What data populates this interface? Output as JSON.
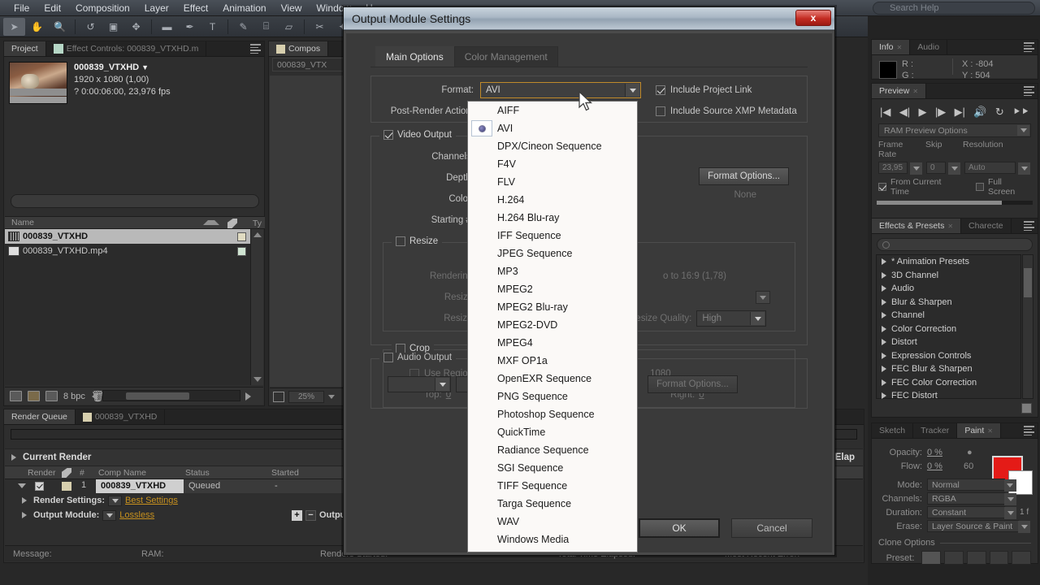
{
  "menubar": {
    "items": [
      "File",
      "Edit",
      "Composition",
      "Layer",
      "Effect",
      "Animation",
      "View",
      "Window",
      "H"
    ],
    "search_placeholder": "Search Help"
  },
  "project_panel": {
    "tabs": [
      {
        "label": "Project",
        "active": true
      },
      {
        "label": "Effect Controls: 000839_VTXHD.m",
        "active": false
      }
    ],
    "item_name": "000839_VTXHD",
    "item_dims": "1920 x 1080 (1,00)",
    "item_duration": "? 0:00:06:00, 23,976 fps",
    "search_placeholder": "",
    "column_name": "Name",
    "column_type": "Ty",
    "rows": [
      {
        "name": "000839_VTXHD",
        "selected": true
      },
      {
        "name": "000839_VTXHD.mp4",
        "selected": false
      }
    ],
    "bit_depth": "8 bpc"
  },
  "comp_panel": {
    "tab_label": "Compos",
    "sub_label": "000839_VTX",
    "zoom": "25%"
  },
  "render_queue": {
    "tabs": [
      {
        "label": "Render Queue",
        "active": true
      },
      {
        "label": "000839_VTXHD",
        "active": false
      }
    ],
    "current_render_label": "Current Render",
    "elapsed_label": "Elap",
    "columns": [
      "Render",
      "#",
      "Comp Name",
      "Status",
      "Started"
    ],
    "row": {
      "index": "1",
      "comp_name": "000839_VTXHD",
      "status": "Queued",
      "started": "-"
    },
    "render_settings_label": "Render Settings:",
    "render_settings_value": "Best Settings",
    "output_module_label": "Output Module:",
    "output_module_value": "Lossless",
    "output_to_label": "Outpu",
    "status_bar": [
      "Message:",
      "RAM:",
      "Renders Started:",
      "Total Time Elapsed:",
      "Most Recent Error:"
    ]
  },
  "info_panel": {
    "tabs": [
      {
        "label": "Info",
        "active": true
      },
      {
        "label": "Audio",
        "active": false
      }
    ],
    "r_label": "R :",
    "g_label": "G :",
    "x_label": "X : -804",
    "y_label": "Y : 504"
  },
  "preview_panel": {
    "tabs": [
      {
        "label": "Preview",
        "active": true
      }
    ],
    "ram_preview_options": "RAM Preview Options",
    "frame_rate_label": "Frame Rate",
    "frame_rate_value": "23,95",
    "skip_label": "Skip",
    "skip_value": "0",
    "resolution_label": "Resolution",
    "resolution_value": "Auto",
    "from_current_time": "From Current Time",
    "full_screen": "Full Screen"
  },
  "effects_panel": {
    "tabs": [
      {
        "label": "Effects & Presets",
        "active": true
      },
      {
        "label": "Charecte",
        "active": false
      }
    ],
    "search_placeholder": "",
    "items": [
      "* Animation Presets",
      "3D Channel",
      "Audio",
      "Blur & Sharpen",
      "Channel",
      "Color Correction",
      "Distort",
      "Expression Controls",
      "FEC Blur & Sharpen",
      "FEC Color Correction",
      "FEC Distort"
    ]
  },
  "paint_panel": {
    "tabs": [
      {
        "label": "Sketch",
        "active": false
      },
      {
        "label": "Tracker",
        "active": false
      },
      {
        "label": "Paint",
        "active": true
      }
    ],
    "opacity_label": "Opacity:",
    "opacity_value": "0 %",
    "flow_label": "Flow:",
    "flow_value": "0 %",
    "brush_size": "60",
    "mode_label": "Mode:",
    "mode_value": "Normal",
    "channels_label": "Channels:",
    "channels_value": "RGBA",
    "duration_label": "Duration:",
    "duration_value": "Constant",
    "erase_label": "Erase:",
    "erase_value": "Layer Source & Paint",
    "clone_options_label": "Clone Options",
    "preset_label": "Preset:",
    "foreground_color": "#e41b17",
    "background_color": "#ffffff"
  },
  "dialog": {
    "title": "Output Module Settings",
    "close_label": "x",
    "tabs": [
      {
        "label": "Main Options",
        "active": true
      },
      {
        "label": "Color Management",
        "active": false
      }
    ],
    "format_label": "Format:",
    "format_value": "AVI",
    "post_render_label": "Post-Render Action:",
    "include_project_link": "Include Project Link",
    "include_xmp": "Include Source XMP Metadata",
    "video_output": "Video Output",
    "channels_label": "Channels:",
    "depth_label": "Depth:",
    "color_label": "Color:",
    "starting_label": "Starting #:",
    "format_options_button": "Format Options...",
    "format_options_value": "None",
    "resize_label": "Resize",
    "resize_note": "o to 16:9 (1,78)",
    "rendering_at_label": "Rendering at:",
    "resize_to_label": "Resize to:",
    "resize_pct_label": "Resize %:",
    "resize_quality_label": "Resize Quality:",
    "resize_quality_value": "High",
    "crop_label": "Crop",
    "use_region_label": "Use Region",
    "top_label": "Top:",
    "top_value": "0",
    "right_label": "Right:",
    "right_value": "0",
    "crop_height": "1080",
    "audio_output": "Audio Output",
    "audio_format_options": "Format Options...",
    "ok_label": "OK",
    "cancel_label": "Cancel"
  },
  "format_dropdown": {
    "selected": "AVI",
    "options": [
      "AIFF",
      "AVI",
      "DPX/Cineon Sequence",
      "F4V",
      "FLV",
      "H.264",
      "H.264 Blu-ray",
      "IFF Sequence",
      "JPEG Sequence",
      "MP3",
      "MPEG2",
      "MPEG2 Blu-ray",
      "MPEG2-DVD",
      "MPEG4",
      "MXF OP1a",
      "OpenEXR Sequence",
      "PNG Sequence",
      "Photoshop Sequence",
      "QuickTime",
      "Radiance Sequence",
      "SGI Sequence",
      "TIFF Sequence",
      "Targa Sequence",
      "WAV",
      "Windows Media"
    ]
  },
  "colors": {
    "accent_orange": "#c8911e",
    "dialog_bg": "#3a3a3a",
    "app_bg": "#282828",
    "close_red": "#c32b22"
  }
}
